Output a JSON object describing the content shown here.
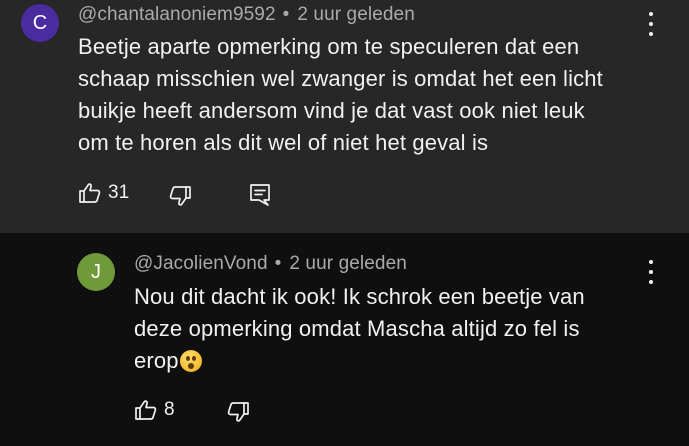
{
  "comments": [
    {
      "avatar_letter": "C",
      "avatar_color": "#4a2ba0",
      "author": "@chantalanoniem9592",
      "separator": "•",
      "time": "2 uur geleden",
      "lines": [
        "Beetje aparte opmerking om te speculeren dat een",
        "schaap misschien wel zwanger is omdat het een licht",
        "buikje heeft andersom vind je dat vast ook niet leuk",
        "om te horen als dit wel of niet het geval is"
      ],
      "likes": "31"
    },
    {
      "avatar_letter": "J",
      "avatar_color": "#6f9a3a",
      "author": "@JacolienVond",
      "separator": "•",
      "time": "2 uur geleden",
      "lines": [
        "Nou dit dacht ik ook! Ik schrok een beetje van",
        "deze opmerking omdat Mascha altijd zo fel is",
        "erop"
      ],
      "emoji_icon": "astonished-face-emoji",
      "likes": "8"
    }
  ],
  "icons": {
    "like": "thumbs-up-icon",
    "dislike": "thumbs-down-icon",
    "reply": "reply-comment-icon",
    "menu": "more-vertical-icon"
  }
}
